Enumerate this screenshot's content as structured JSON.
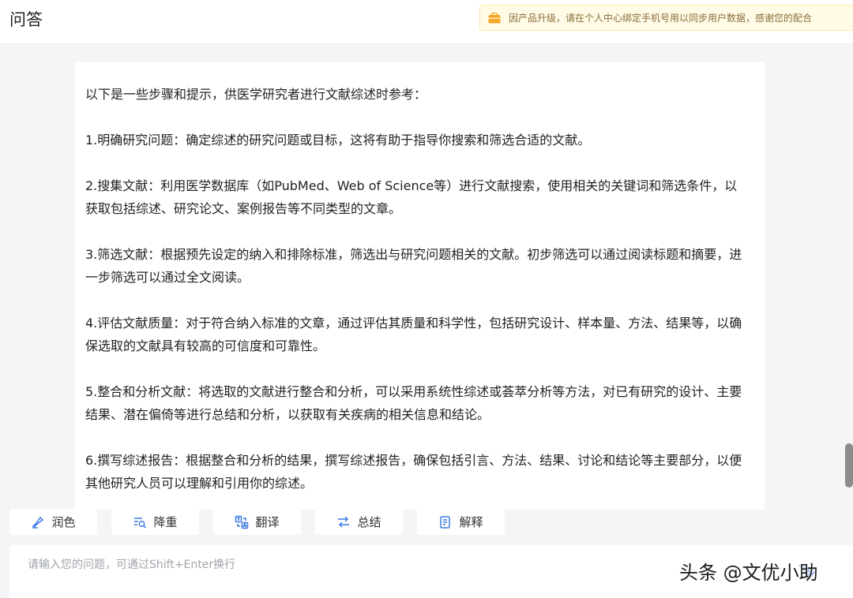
{
  "header": {
    "title": "问答",
    "notice": "因产品升级，请在个人中心绑定手机号用以同步用户数据，感谢您的配合"
  },
  "answer": {
    "paragraphs": [
      "以下是一些步骤和提示，供医学研究者进行文献综述时参考：",
      "1.明确研究问题：确定综述的研究问题或目标，这将有助于指导你搜索和筛选合适的文献。",
      "2.搜集文献：利用医学数据库（如PubMed、Web of Science等）进行文献搜索，使用相关的关键词和筛选条件，以获取包括综述、研究论文、案例报告等不同类型的文章。",
      "3.筛选文献：根据预先设定的纳入和排除标准，筛选出与研究问题相关的文献。初步筛选可以通过阅读标题和摘要，进一步筛选可以通过全文阅读。",
      "4.评估文献质量：对于符合纳入标准的文章，通过评估其质量和科学性，包括研究设计、样本量、方法、结果等，以确保选取的文献具有较高的可信度和可靠性。",
      "5.整合和分析文献：将选取的文献进行整合和分析，可以采用系统性综述或荟萃分析等方法，对已有研究的设计、主要结果、潜在偏倚等进行总结和分析，以获取有关疾病的相关信息和结论。",
      "6.撰写综述报告：根据整合和分析的结果，撰写综述报告，确保包括引言、方法、结果、讨论和结论等主要部分，以便其他研究人员可以理解和引用你的综述。"
    ]
  },
  "tools": [
    {
      "label": "润色",
      "icon": "polish-icon"
    },
    {
      "label": "降重",
      "icon": "dedupe-icon"
    },
    {
      "label": "翻译",
      "icon": "translate-icon"
    },
    {
      "label": "总结",
      "icon": "summary-icon"
    },
    {
      "label": "解释",
      "icon": "explain-icon"
    }
  ],
  "input": {
    "placeholder": "请输入您的问题，可通过Shift+Enter换行",
    "value": ""
  },
  "watermark": "头条 @文优小助",
  "colors": {
    "accent": "#3c7be0",
    "notice_bg": "#fffbe6",
    "notice_icon": "#f5a623"
  }
}
